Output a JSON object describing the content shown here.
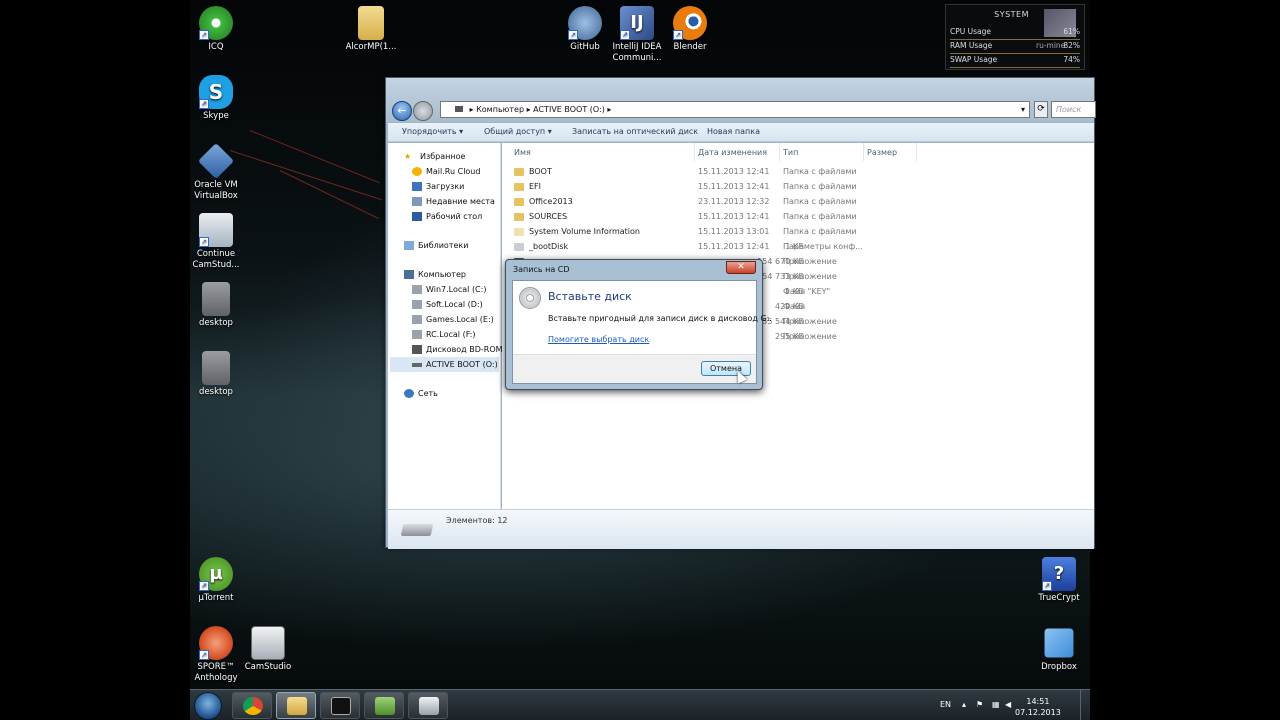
{
  "desktop": {
    "icons_left": [
      {
        "label": "ICQ",
        "icon": "icq-flower-icon",
        "color": "#3cb93c"
      },
      {
        "label": "Skype",
        "icon": "skype-icon",
        "color": "#1fa0e2"
      },
      {
        "label": "Oracle VM VirtualBox",
        "icon": "virtualbox-icon",
        "color": "#2b5fa6"
      },
      {
        "label": "Continue CamStud...",
        "icon": "camstudio-installer-icon",
        "color": "#c9d2dc"
      },
      {
        "label": "desktop",
        "icon": "gear-file-icon",
        "color": "#8c8f93"
      },
      {
        "label": "desktop",
        "icon": "gear-file-icon",
        "color": "#8c8f93"
      }
    ],
    "icons_top": [
      {
        "label": "AlcorMP(1...",
        "icon": "folder-icon",
        "color": "#e8c56a"
      },
      {
        "label": "GitHub",
        "icon": "github-icon",
        "color": "#5b7fa9"
      },
      {
        "label": "IntelliJ IDEA Communi...",
        "icon": "intellij-icon",
        "color": "#3a5c9c"
      },
      {
        "label": "Blender",
        "icon": "blender-icon",
        "color": "#e87d0d"
      }
    ],
    "icons_bottom_left": [
      {
        "label": "µTorrent",
        "icon": "utorrent-icon",
        "color": "#5aa82e"
      },
      {
        "label": "SPORE™ Anthology",
        "icon": "spore-icon",
        "color": "#d9552b"
      },
      {
        "label": "CamStudio",
        "icon": "camstudio-icon",
        "color": "#d4d6d9"
      }
    ],
    "icons_right": [
      {
        "label": "TrueCrypt",
        "icon": "truecrypt-icon",
        "color": "#2b59c3"
      },
      {
        "label": "Dropbox",
        "icon": "dropbox-icon",
        "color": "#3d8ed9"
      }
    ]
  },
  "widget": {
    "title": "SYSTEM",
    "rows": [
      {
        "label": "CPU Usage",
        "value": "61%"
      },
      {
        "label": "RAM Usage",
        "value": "82%"
      },
      {
        "label": "SWAP Usage",
        "value": "74%"
      }
    ],
    "overlay": "ru-mine"
  },
  "explorer": {
    "address": [
      "Компьютер",
      "ACTIVE BOOT (O:)"
    ],
    "search_placeholder": "Поиск",
    "toolbar": [
      "Упорядочить ▾",
      "Общий доступ ▾",
      "Записать на оптический диск",
      "Новая папка"
    ],
    "nav": {
      "favorites": "Избранное",
      "favorites_items": [
        "Mail.Ru Cloud",
        "Загрузки",
        "Недавние места",
        "Рабочий стол"
      ],
      "libraries": "Библиотеки",
      "computer": "Компьютер",
      "drives": [
        "Win7.Local (C:)",
        "Soft.Local (D:)",
        "Games.Local (E:)",
        "RC.Local (F:)",
        "Дисковод BD-ROM",
        "ACTIVE BOOT (O:)"
      ],
      "network": "Сеть"
    },
    "columns": [
      "Имя",
      "Дата изменения",
      "Тип",
      "Размер"
    ],
    "files": [
      {
        "name": "BOOT",
        "date": "15.11.2013 12:41",
        "type": "Папка с файлами",
        "size": ""
      },
      {
        "name": "EFI",
        "date": "15.11.2013 12:41",
        "type": "Папка с файлами",
        "size": ""
      },
      {
        "name": "Office2013",
        "date": "23.11.2013 12:32",
        "type": "Папка с файлами",
        "size": ""
      },
      {
        "name": "SOURCES",
        "date": "15.11.2013 12:41",
        "type": "Папка с файлами",
        "size": ""
      },
      {
        "name": "System Volume Information",
        "date": "15.11.2013 13:01",
        "type": "Папка с файлами",
        "size": ""
      },
      {
        "name": "_bootDisk",
        "date": "15.11.2013 12:41",
        "type": "Параметры конф...",
        "size": "1 КБ"
      },
      {
        "name": "",
        "date": "",
        "type": "Приложение",
        "size": "154 670 КБ"
      },
      {
        "name": "",
        "date": "",
        "type": "Приложение",
        "size": "154 733 КБ"
      },
      {
        "name": "",
        "date": "",
        "type": "Файл \"KEY\"",
        "size": "1 КБ"
      },
      {
        "name": "",
        "date": "",
        "type": "Файл",
        "size": "429 КБ"
      },
      {
        "name": "",
        "date": "",
        "type": "Приложение",
        "size": "55 544 КБ"
      },
      {
        "name": "",
        "date": "",
        "type": "Приложение",
        "size": "295 КБ"
      }
    ],
    "status": "Элементов: 12"
  },
  "dialog": {
    "title": "Запись на CD",
    "close": "✕",
    "heading": "Вставьте диск",
    "text": "Вставьте пригодный для записи диск в дисковод G:.",
    "link": "Помогите выбрать диск",
    "cancel": "Отмена"
  },
  "taskbar": {
    "apps": [
      {
        "icon": "chrome-icon",
        "color": "#e8b82e"
      },
      {
        "icon": "explorer-folder-icon",
        "color": "#e8c56a"
      },
      {
        "icon": "cmd-icon",
        "color": "#1b1b1b"
      },
      {
        "icon": "network-manager-icon",
        "color": "#6aa24a"
      },
      {
        "icon": "camstudio-icon",
        "color": "#cfd3d8"
      }
    ],
    "lang": "EN",
    "time": "14:51",
    "date": "07.12.2013"
  }
}
